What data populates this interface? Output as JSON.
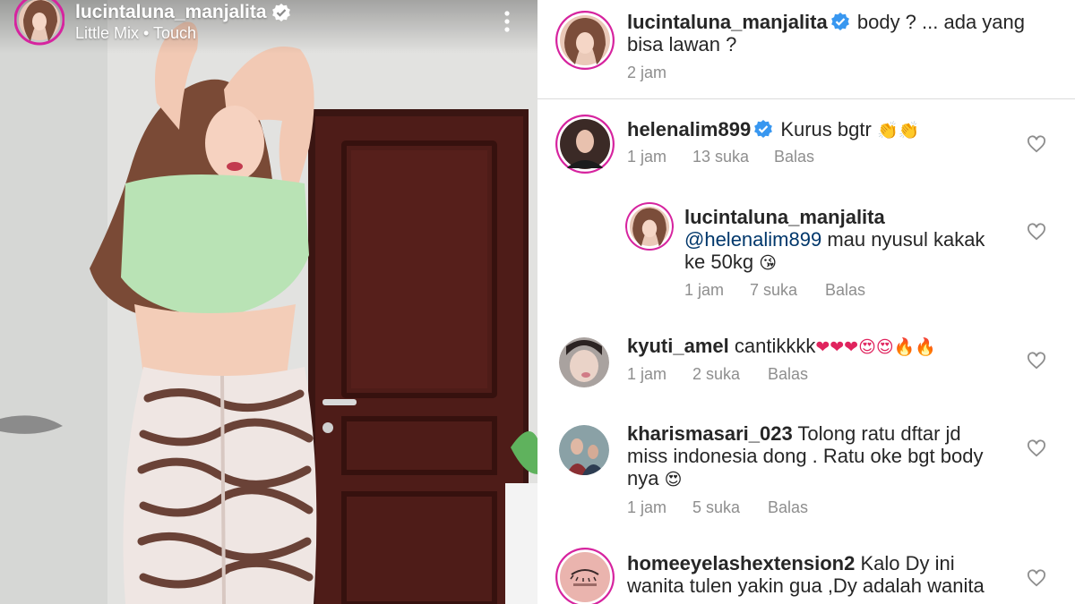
{
  "reel": {
    "username": "lucintaluna_manjalita",
    "audio": "Little Mix • Touch"
  },
  "post": {
    "username": "lucintaluna_manjalita",
    "caption_line1": "body ? ... ada yang",
    "caption_line2": "bisa lawan ?",
    "time": "2 jam"
  },
  "comments": [
    {
      "username": "helenalim899",
      "verified": true,
      "text": "Kurus bgtr",
      "emoji": "👏👏",
      "time": "1 jam",
      "likes": "13 suka",
      "reply": "Balas"
    },
    {
      "username": "lucintaluna_manjalita",
      "mention": "@helenalim899",
      "text_line1": "mau nyusul kakak",
      "text_line2": "ke 50kg",
      "emoji": "😘",
      "time": "1 jam",
      "likes": "7 suka",
      "reply": "Balas"
    },
    {
      "username": "kyuti_amel",
      "text": "cantikkkk",
      "emoji": "❤❤❤😍😍🔥🔥",
      "time": "1 jam",
      "likes": "2 suka",
      "reply": "Balas"
    },
    {
      "username": "kharismasari_023",
      "text_line1": "Tolong ratu dftar jd",
      "text_line2": "miss indonesia dong . Ratu oke bgt body",
      "text_line3": "nya",
      "emoji": "😍",
      "time": "1 jam",
      "likes": "5 suka",
      "reply": "Balas"
    },
    {
      "username": "homeeyelashextension2",
      "text_line1": "Kalo Dy ini",
      "text_line2": "wanita tulen yakin gua ,Dy adalah wanita"
    }
  ],
  "colors": {
    "verified_blue": "#3897f0",
    "meta_gray": "#8e8e8e",
    "mention_blue": "#00376b",
    "text": "#262626"
  }
}
